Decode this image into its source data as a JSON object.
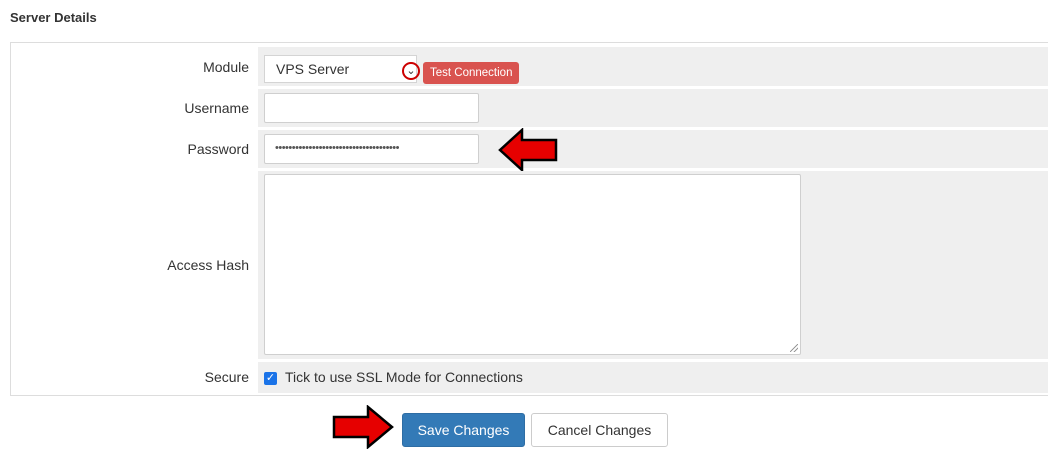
{
  "section": {
    "title": "Server Details"
  },
  "form": {
    "module": {
      "label": "Module",
      "value": "VPS Server",
      "test_button": "Test Connection"
    },
    "username": {
      "label": "Username",
      "value": ""
    },
    "password": {
      "label": "Password",
      "value": "•••••••••••••••••••••••••••••••••••••"
    },
    "access_hash": {
      "label": "Access Hash",
      "value": ""
    },
    "secure": {
      "label": "Secure",
      "checkbox_label": "Tick to use SSL Mode for Connections",
      "checked": true
    }
  },
  "actions": {
    "save_label": "Save Changes",
    "cancel_label": "Cancel Changes"
  },
  "colors": {
    "primary": "#337ab7",
    "danger": "#d9534f",
    "annotation": "#e60000"
  },
  "icons": {
    "dropdown": "chevron-down-icon",
    "checkbox": "checkmark-icon",
    "annotation": "arrow-right-icon"
  }
}
